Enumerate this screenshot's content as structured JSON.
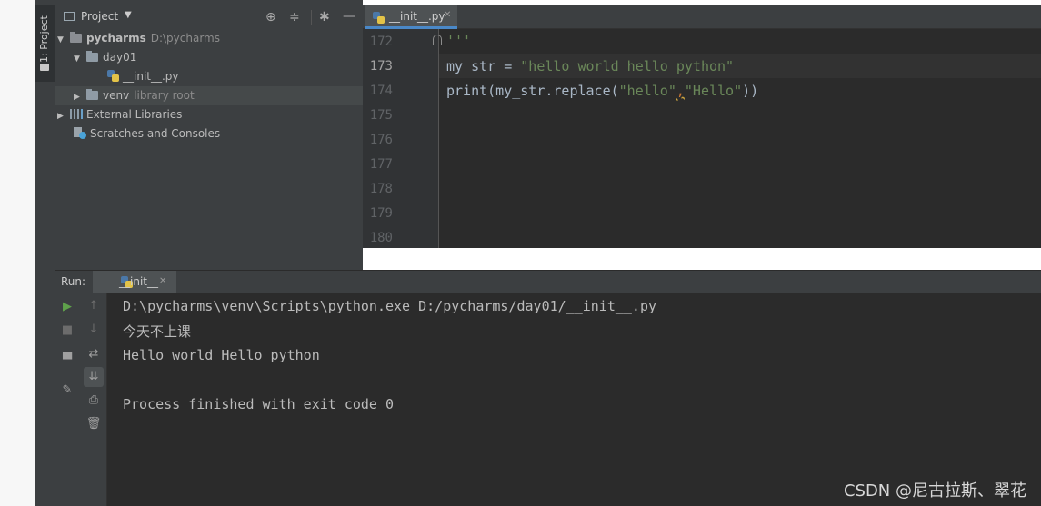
{
  "sidebar": {
    "project_tab_label": "1: Project"
  },
  "project_panel": {
    "title": "Project",
    "tree": {
      "root": {
        "name": "pycharms",
        "path": "D:\\pycharms"
      },
      "day01": "day01",
      "init_file": "__init__.py",
      "venv": {
        "name": "venv",
        "note": "library root"
      },
      "external_libraries": "External Libraries",
      "scratches": "Scratches and Consoles"
    }
  },
  "editor": {
    "tab_label": "__init__.py",
    "line_numbers": [
      "172",
      "173",
      "174",
      "175",
      "176",
      "177",
      "178",
      "179",
      "180"
    ],
    "code": {
      "line172": "'''",
      "line173_var": "my_str = ",
      "line173_str": "\"hello world hello python\"",
      "line174_a": "print(my_str.replace(",
      "line174_s1": "\"hello\"",
      "line174_comma": ",",
      "line174_s2": "\"Hello\"",
      "line174_end": "))"
    }
  },
  "run_panel": {
    "label": "Run:",
    "tab_label": "__init__",
    "output": [
      "D:\\pycharms\\venv\\Scripts\\python.exe D:/pycharms/day01/__init__.py",
      "今天不上课",
      "Hello world Hello python",
      "",
      "Process finished with exit code 0"
    ]
  },
  "watermark": "CSDN @尼古拉斯、翠花",
  "colors": {
    "accent": "#4a88c7",
    "string": "#6a8759",
    "code": "#a9b7c6",
    "run_green": "#5fa14b"
  }
}
